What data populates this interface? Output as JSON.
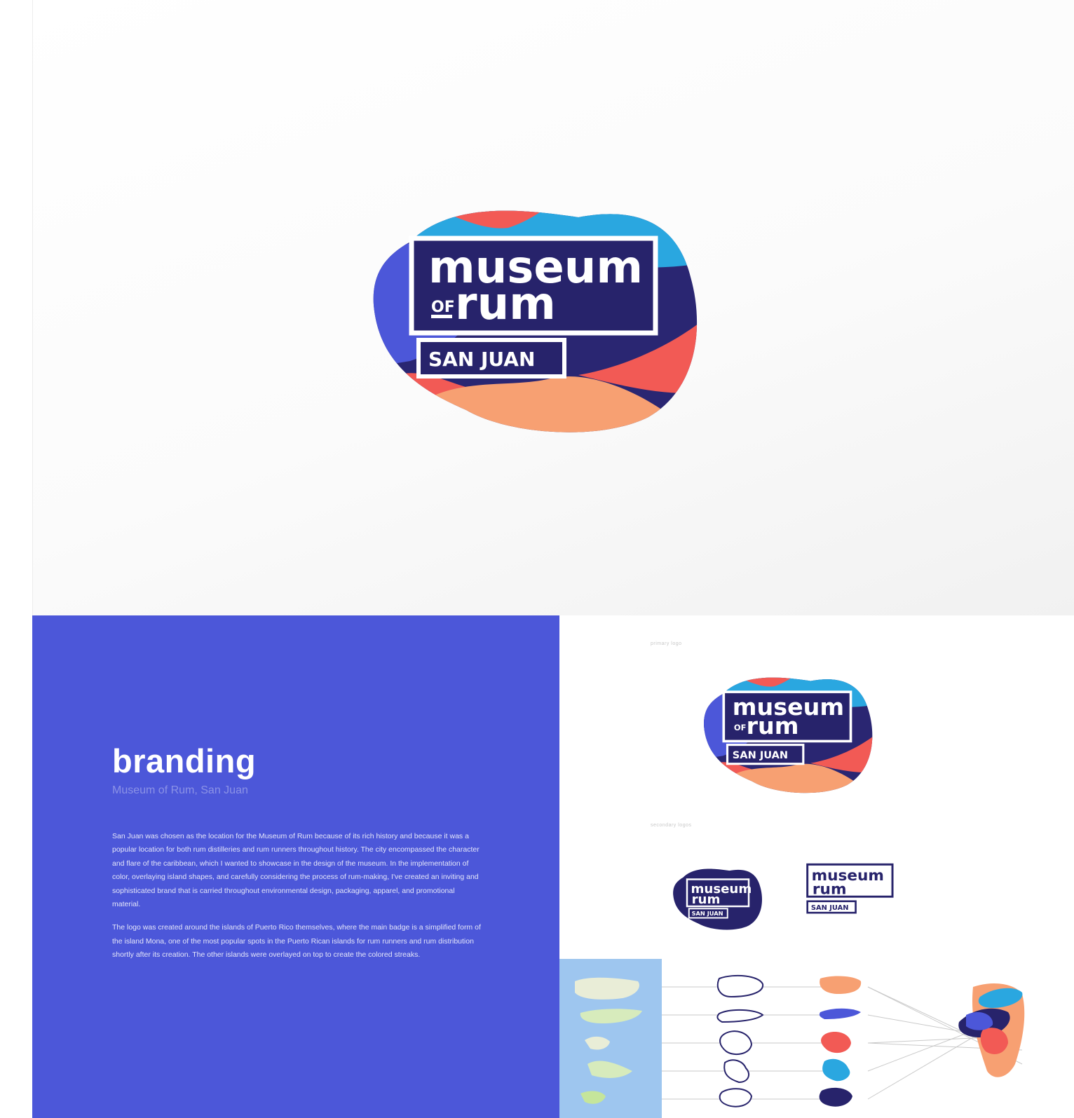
{
  "logo": {
    "word1": "museum",
    "word2_small": "OF",
    "word2": "rum",
    "location": "SAN JUAN"
  },
  "branding": {
    "title": "branding",
    "subtitle": "Museum of Rum, San Juan",
    "paragraphs": [
      "San Juan was chosen as the location for the Museum of Rum because of its rich history and because it was a popular location for both rum distilleries and rum runners throughout history. The city encompassed the character and flare of the caribbean, which I wanted to showcase in the design of the museum. In the implementation of color, overlaying island shapes, and carefully considering the process of rum-making, I've created an inviting and sophisticated brand that is carried throughout environmental design, packaging, apparel, and promotional material.",
      "The logo was created around the islands of Puerto Rico themselves, where the main badge is a simplified form of the island Mona, one of the most popular spots in the Puerto Rican islands for rum runners and rum distribution shortly after its creation. The other islands were overlayed on top to create the colored streaks."
    ]
  },
  "sheet": {
    "label_primary": "primary logo",
    "label_secondary": "secondary logos"
  },
  "colors": {
    "blue": "#4c57d9",
    "navy": "#27236b",
    "coral": "#f25a55",
    "cyan": "#2aa7e0",
    "peach": "#f7a072",
    "map": "#9ec6ef"
  }
}
